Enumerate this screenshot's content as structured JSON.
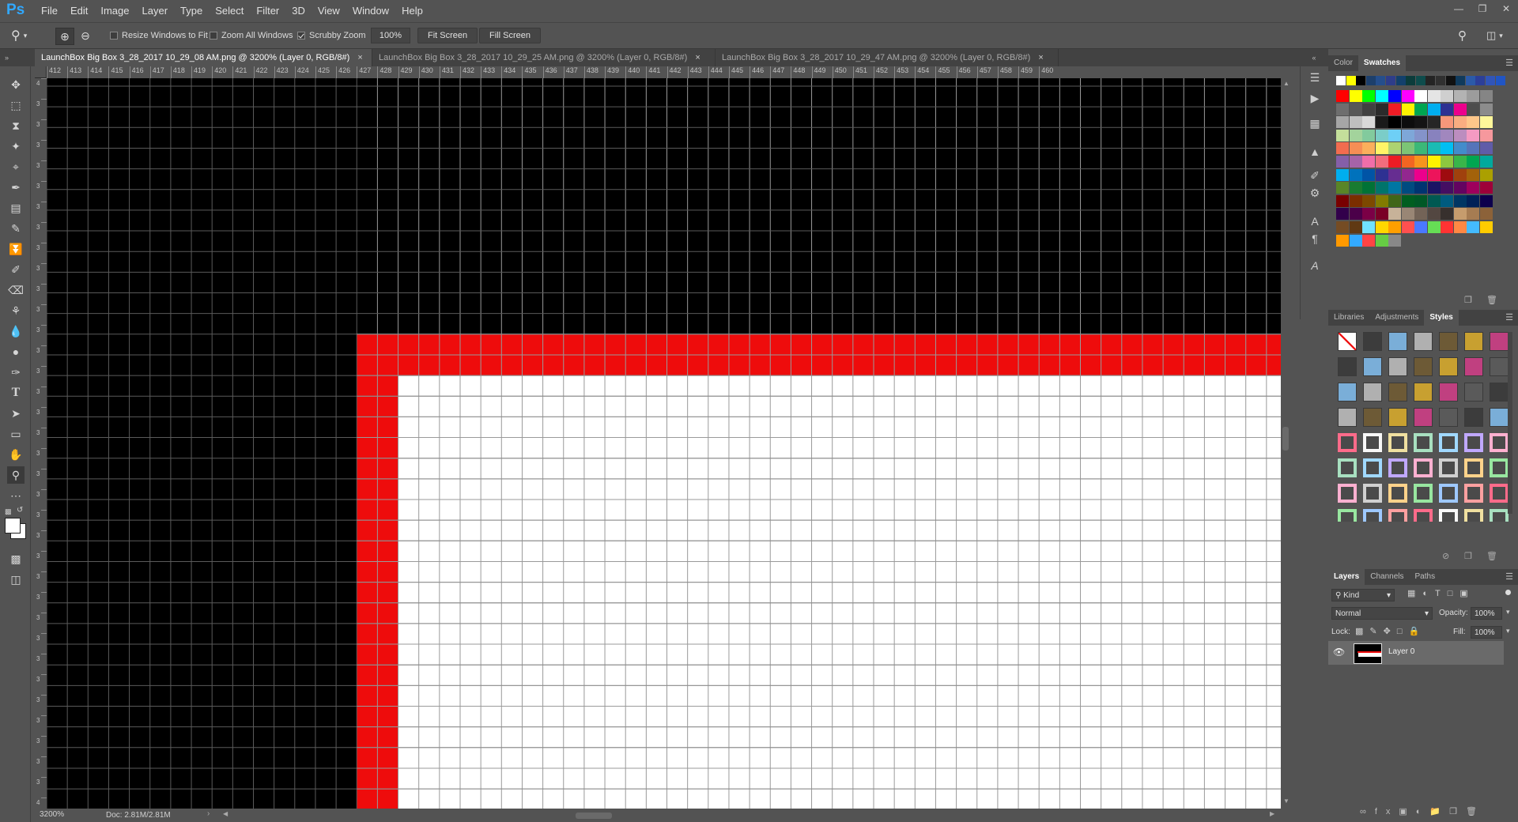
{
  "app": {
    "logo": "Ps",
    "menus": [
      "File",
      "Edit",
      "Image",
      "Layer",
      "Type",
      "Select",
      "Filter",
      "3D",
      "View",
      "Window",
      "Help"
    ]
  },
  "options": {
    "resize_windows": "Resize Windows to Fit",
    "zoom_all": "Zoom All Windows",
    "scrubby_zoom": "Scrubby Zoom",
    "zoom_value": "100%",
    "fit_screen": "Fit Screen",
    "fill_screen": "Fill Screen",
    "resize_checked": false,
    "zoom_all_checked": false,
    "scrubby_checked": true
  },
  "tabs": [
    {
      "label": "LaunchBox Big Box 3_28_2017 10_29_08 AM.png @ 3200% (Layer 0, RGB/8#)",
      "active": true
    },
    {
      "label": "LaunchBox Big Box 3_28_2017 10_29_25 AM.png @ 3200% (Layer 0, RGB/8#)",
      "active": false
    },
    {
      "label": "LaunchBox Big Box 3_28_2017 10_29_47 AM.png @ 3200% (Layer 0, RGB/8#)",
      "active": false
    }
  ],
  "ruler_top": [
    "412",
    "413",
    "414",
    "415",
    "416",
    "417",
    "418",
    "419",
    "420",
    "421",
    "422",
    "423",
    "424",
    "425",
    "426",
    "427",
    "428",
    "429",
    "430",
    "431",
    "432",
    "433",
    "434",
    "435",
    "436",
    "437",
    "438",
    "439",
    "440",
    "441",
    "442",
    "443",
    "444",
    "445",
    "446",
    "447",
    "448",
    "449",
    "450",
    "451",
    "452",
    "453",
    "454",
    "455",
    "456",
    "457",
    "458",
    "459",
    "460"
  ],
  "ruler_left": [
    "4",
    "3",
    "3",
    "3",
    "3",
    "3",
    "3",
    "3",
    "3",
    "3",
    "3",
    "3",
    "3",
    "3",
    "3",
    "3",
    "3",
    "3",
    "3",
    "3",
    "3",
    "3",
    "3",
    "3",
    "3",
    "3",
    "3",
    "3",
    "3",
    "3",
    "3",
    "3",
    "3",
    "3",
    "3",
    "4"
  ],
  "status": {
    "zoom": "3200%",
    "doc": "Doc: 2.81M/2.81M"
  },
  "colors": {
    "black_fill": "#000000",
    "red_fill": "#ee0c0c",
    "white_fill": "#ffffff",
    "grid_on_black": "#5a5a5a",
    "grid_on_light": "#9a9a9a"
  },
  "swatch_panel": {
    "tab_color": "Color",
    "tab_swatches": "Swatches",
    "rows": [
      [
        "#ffffff",
        "#ffff00",
        "#000000",
        "#1d3f6b",
        "#254e8c",
        "#2e3d8a",
        "#12406c",
        "#0b3c3b",
        "#0e4c4c",
        "#242424",
        "#303030",
        "#111111",
        "#103a5c",
        "#2b5aa8",
        "#2c3f99",
        "#3155b8",
        "#2155c4"
      ],
      [
        "#ff0000",
        "#ffff00",
        "#00ff00",
        "#00ffff",
        "#0000ff",
        "#ff00ff",
        "#ffffff",
        "#e5e5e5",
        "#cfcfcf",
        "#b3b3b3",
        "#9c9c9c",
        "#858585"
      ],
      [
        "#6e6e6e",
        "#575757",
        "#414141",
        "#2b2b2b",
        "#ef1c25",
        "#fff200",
        "#00a651",
        "#00aeef",
        "#2e3192",
        "#ec008c",
        "#4d4d4d",
        "#8c8c8c"
      ],
      [
        "#a6a6a6",
        "#bfbfbf",
        "#d9d9d9",
        "#1a1a1a",
        "#000000",
        "#0d0d0d",
        "#141414",
        "#262626",
        "#f7977a",
        "#f9ad81",
        "#fdc68a",
        "#fff79a"
      ],
      [
        "#c4df9b",
        "#a3d39c",
        "#82ca9d",
        "#7bcdc8",
        "#6ecff6",
        "#7ea7d8",
        "#8493ca",
        "#8882be",
        "#a187be",
        "#bc8dbf",
        "#f49ac2",
        "#f6989d"
      ],
      [
        "#f26c4f",
        "#f68e55",
        "#fbaf5c",
        "#fff467",
        "#acd372",
        "#7cc576",
        "#3bb878",
        "#1abbb4",
        "#00bff3",
        "#438ccb",
        "#5574b9",
        "#605ca8"
      ],
      [
        "#855fa8",
        "#a763a8",
        "#f06ea9",
        "#f26d7d",
        "#ed1c24",
        "#f26522",
        "#f7941d",
        "#fff200",
        "#8dc63f",
        "#39b54a",
        "#00a651",
        "#00a99d"
      ],
      [
        "#00aeef",
        "#0072bc",
        "#0054a6",
        "#2e3192",
        "#662d91",
        "#92278f",
        "#ec008c",
        "#ed145b",
        "#9e0b0f",
        "#a0410d",
        "#a3620a",
        "#aba000"
      ],
      [
        "#598527",
        "#197b30",
        "#007236",
        "#00746b",
        "#0076a3",
        "#004b80",
        "#003471",
        "#1b1464",
        "#440e62",
        "#630460",
        "#9e005d",
        "#9e0039"
      ],
      [
        "#790000",
        "#7b2e00",
        "#7d4900",
        "#827b00",
        "#406618",
        "#005e20",
        "#005826",
        "#005952",
        "#005b7f",
        "#003663",
        "#002157",
        "#0d004c"
      ],
      [
        "#32004b",
        "#4b0049",
        "#7b0046",
        "#7a0026",
        "#c7b299",
        "#998675",
        "#736357",
        "#534741",
        "#37302d",
        "#c69c6d",
        "#a67c52",
        "#8c6239"
      ],
      [
        "#754c24",
        "#603913",
        "#70e2ff",
        "#ffd700",
        "#ff9f00",
        "#ff5050",
        "#4a78ff",
        "#66dd55",
        "#ff3333",
        "#ff8844",
        "#44bbff",
        "#ffcc00"
      ],
      [
        "#ff9900",
        "#33aaff",
        "#ff4444",
        "#66cc44",
        "#888888"
      ]
    ]
  },
  "styles_panel": {
    "tab_libraries": "Libraries",
    "tab_adjustments": "Adjustments",
    "tab_styles": "Styles"
  },
  "layers_panel": {
    "tab_layers": "Layers",
    "tab_channels": "Channels",
    "tab_paths": "Paths",
    "kind": "Kind",
    "blend_mode": "Normal",
    "opacity_label": "Opacity:",
    "opacity_value": "100%",
    "lock_label": "Lock:",
    "fill_label": "Fill:",
    "fill_value": "100%",
    "layer_name": "Layer 0"
  }
}
